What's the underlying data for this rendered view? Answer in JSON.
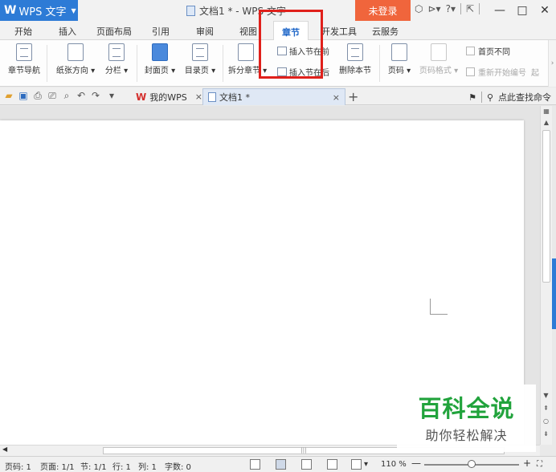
{
  "titlebar": {
    "app_name": "WPS 文字",
    "doc_title": "文档1 * - WPS 文字",
    "login_label": "未登录",
    "icons": [
      "skin-icon",
      "share-icon",
      "help-icon",
      "collapse-ribbon-icon"
    ],
    "help_label": "?",
    "window_controls": [
      "—",
      "□",
      "✕"
    ]
  },
  "tabs": [
    "开始",
    "插入",
    "页面布局",
    "引用",
    "审阅",
    "视图",
    "章节",
    "开发工具",
    "云服务"
  ],
  "active_tab": "章节",
  "ribbon": {
    "nav": "章节导航",
    "orientation": "纸张方向",
    "columns": "分栏",
    "cover": "封面页",
    "toc": "目录页",
    "split": "拆分章节",
    "insert_before": "插入节在前",
    "insert_after": "插入节在后",
    "delete_section": "删除本节",
    "page_number": "页码",
    "page_number_format": "页码格式",
    "first_page_diff": "首页不同",
    "restart_numbering": "重新开始编号",
    "start": "起"
  },
  "doc_tabs": {
    "home": "我的WPS",
    "current": "文档1 *",
    "find_command": "点此查找命令"
  },
  "statusbar": {
    "page_code": "页码: 1",
    "page": "页面: 1/1",
    "section": "节: 1/1",
    "row": "行: 1",
    "col": "列: 1",
    "words": "字数: 0",
    "zoom": "110 %",
    "zoom_level": 0.5
  },
  "watermark": {
    "line1": "百科全说",
    "line2": "助你轻松解决"
  },
  "colors": {
    "app_blue": "#2d7bd6",
    "login_orange": "#f0653c",
    "highlight_red": "#e0201b",
    "watermark_green": "#21a33c"
  }
}
